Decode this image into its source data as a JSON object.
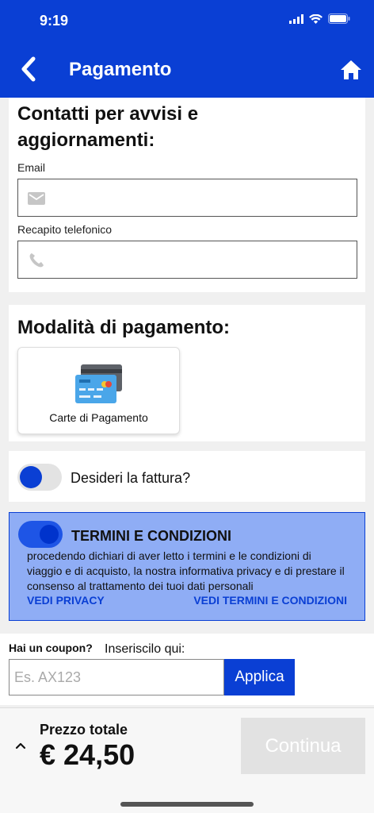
{
  "status_bar": {
    "time": "9:19"
  },
  "nav": {
    "title": "Pagamento",
    "back_icon": "chevron-left-icon",
    "home_icon": "home-icon"
  },
  "contacts": {
    "title_line1": "Contatti per avvisi e",
    "title_line2": "aggiornamenti:",
    "email_label": "Email",
    "email_value": "",
    "phone_label": "Recapito telefonico",
    "phone_value": ""
  },
  "payment": {
    "title": "Modalità di pagamento:",
    "method_label": "Carte di Pagamento",
    "method_icon": "credit-cards-icon"
  },
  "invoice": {
    "label": "Desideri la fattura?",
    "enabled": false
  },
  "terms": {
    "enabled": true,
    "title": "TERMINI E CONDIZIONI",
    "text": "procedendo dichiari di aver letto i termini e le condizioni di viaggio e di acquisto, la nostra informativa privacy e di prestare il consenso al trattamento dei tuoi dati personali",
    "privacy_link": "VEDI PRIVACY",
    "conditions_link": "VEDI TERMINI E CONDIZIONI"
  },
  "coupon": {
    "question": "Hai un coupon?",
    "hint": "Inseriscilo qui:",
    "placeholder": "Es. AX123",
    "apply_label": "Applica"
  },
  "footer": {
    "price_label": "Prezzo totale",
    "price": "€ 24,50",
    "continue_label": "Continua"
  },
  "colors": {
    "primary": "#0a3fd4",
    "terms_bg": "#8fadf5",
    "disabled_button": "#e2e2e2"
  }
}
